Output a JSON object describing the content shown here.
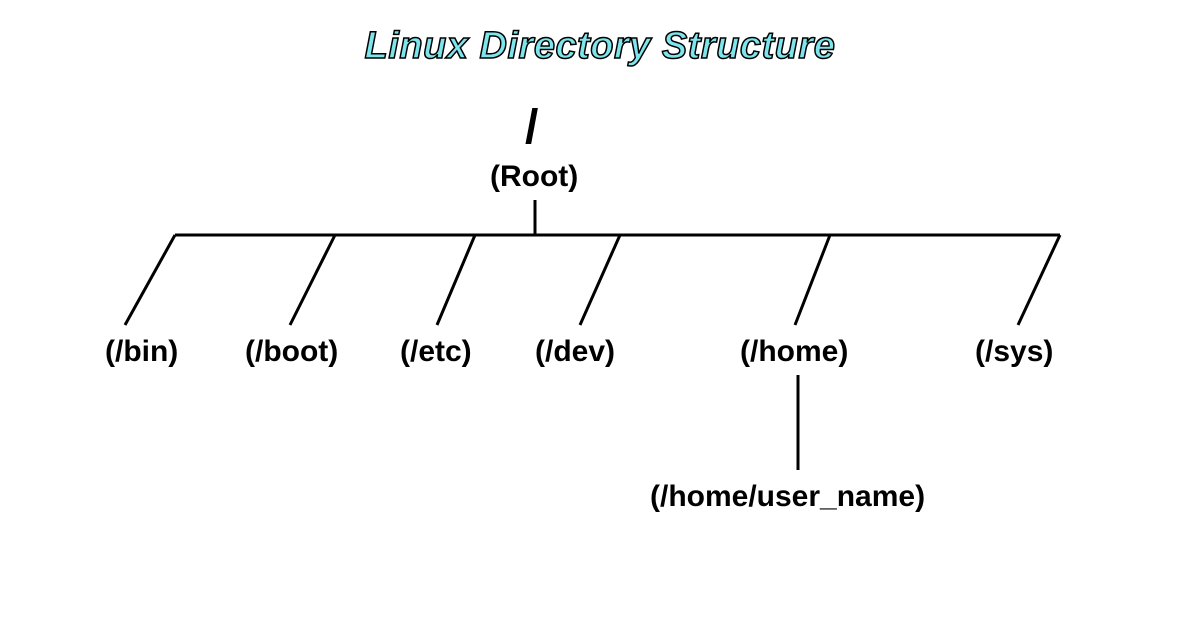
{
  "title": "Linux Directory Structure",
  "root": {
    "symbol": "/",
    "label": "(Root)"
  },
  "children": {
    "bin": "(/bin)",
    "boot": "(/boot)",
    "etc": "(/etc)",
    "dev": "(/dev)",
    "home": "(/home)",
    "sys": "(/sys)"
  },
  "subchild": {
    "username": "(/home/user_name)"
  }
}
